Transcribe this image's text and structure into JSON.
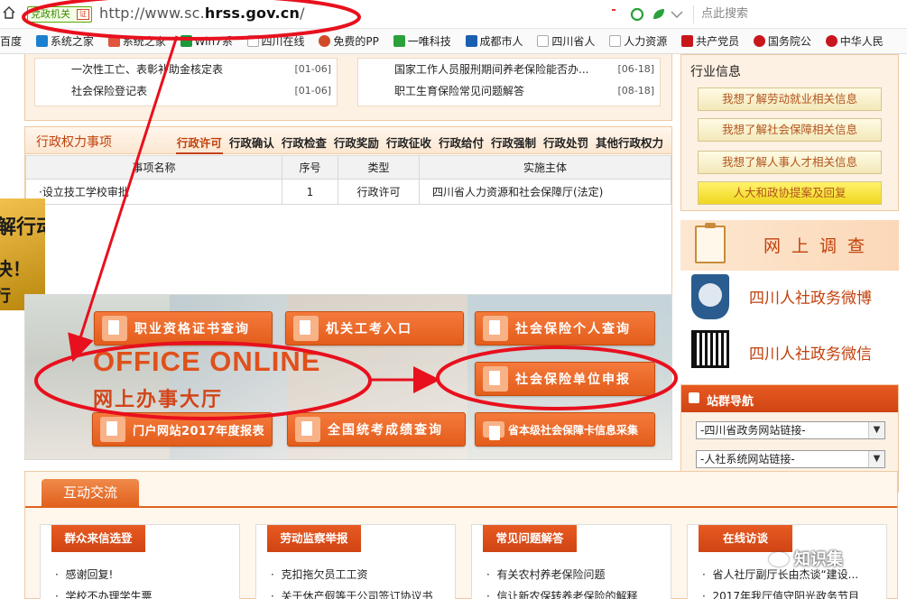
{
  "browser": {
    "badge_label": "党政机关",
    "badge_mark": "证",
    "url_prefix": "http://www.sc.",
    "url_domain": "hrss.gov.cn",
    "url_suffix": "/",
    "search_placeholder": "点此搜索"
  },
  "favorites": [
    {
      "label": "百度",
      "color": "#2a5bd7"
    },
    {
      "label": "系统之家",
      "color": "#1b7fd0"
    },
    {
      "label": "系统之家",
      "color": "#e0553c"
    },
    {
      "label": "Win7系",
      "color": "#1a9a3a"
    },
    {
      "label": "四川在线",
      "color": "#bbbbbb"
    },
    {
      "label": "免费的PP",
      "color": "#d04a2a"
    },
    {
      "label": "一唯科技",
      "color": "#2aa13a"
    },
    {
      "label": "成都市人",
      "color": "#1b5fb0"
    },
    {
      "label": "四川省人",
      "color": "#bbbbbb"
    },
    {
      "label": "人力资源",
      "color": "#bbbbbb"
    },
    {
      "label": "共产党员",
      "color": "#c8161d"
    },
    {
      "label": "国务院公",
      "color": "#c8161d"
    },
    {
      "label": "中华人民",
      "color": "#c8161d"
    }
  ],
  "notices": {
    "left": [
      {
        "title": "一次性工亡、表彰补助金核定表",
        "date": "[01-06]"
      },
      {
        "title": "社会保险登记表",
        "date": "[01-06]"
      }
    ],
    "right": [
      {
        "title": "国家工作人员服刑期间养老保险能否办...",
        "date": "[06-18]"
      },
      {
        "title": "职工生育保险常见问题解答",
        "date": "[08-18]"
      }
    ]
  },
  "power": {
    "title": "行政权力事项",
    "tabs": [
      "行政许可",
      "行政确认",
      "行政检查",
      "行政奖励",
      "行政征收",
      "行政给付",
      "行政强制",
      "行政处罚",
      "其他行政权力"
    ],
    "active_tab": 0,
    "columns": [
      "事项名称",
      "序号",
      "类型",
      "实施主体"
    ],
    "rows": [
      {
        "name": "·设立技工学校审批",
        "no": "1",
        "type": "行政许可",
        "body": "四川省人力资源和社会保障厅(法定)"
      }
    ]
  },
  "side_ad": {
    "line1": "解行动",
    "line2": "决！",
    "line3": "行"
  },
  "office": {
    "headline": "OFFICE ONLINE",
    "subline": "网上办事大厅",
    "buttons": [
      {
        "label": "职业资格证书查询"
      },
      {
        "label": "机关工考入口"
      },
      {
        "label": "社会保险个人查询"
      },
      {
        "label": "社会保险单位申报"
      },
      {
        "label": "门户网站2017年度报表"
      },
      {
        "label": "全国统考成绩查询"
      },
      {
        "label": "省本级社会保障卡信息采集"
      }
    ]
  },
  "industry": {
    "title": "行业信息",
    "buttons": [
      {
        "label": "我想了解劳动就业相关信息"
      },
      {
        "label": "我想了解社会保障相关信息"
      },
      {
        "label": "我想了解人事人才相关信息"
      },
      {
        "label": "人大和政协提案及回复"
      }
    ]
  },
  "survey": {
    "label": "网上调查"
  },
  "weibo": {
    "label": "四川人社政务微博"
  },
  "weixin": {
    "label": "四川人社政务微信"
  },
  "site_nav": {
    "title": "站群导航",
    "select1": "-四川省政务网站链接-",
    "select2": "-人社系统网站链接-"
  },
  "interact": {
    "title": "互动交流",
    "cards": [
      {
        "title": "群众来信选登",
        "items": [
          "感谢回复!",
          "学校不办理学生票"
        ]
      },
      {
        "title": "劳动监察举报",
        "items": [
          "克扣拖欠员工工资",
          "关于休产假等于公司签订协议书"
        ]
      },
      {
        "title": "常见问题解答",
        "items": [
          "有关农村养老保险问题",
          "信让新农保转养老保险的解释"
        ]
      },
      {
        "title": "在线访谈",
        "items": [
          "省人社厅副厅长由杰谈“建设...",
          "2017年我厅值守阳光政务节目"
        ]
      }
    ]
  },
  "watermark": {
    "label": "知识集"
  },
  "colors": {
    "accent": "#e35d1b",
    "annotation": "#e8101e",
    "panel_bg": "#fdf1e3"
  }
}
